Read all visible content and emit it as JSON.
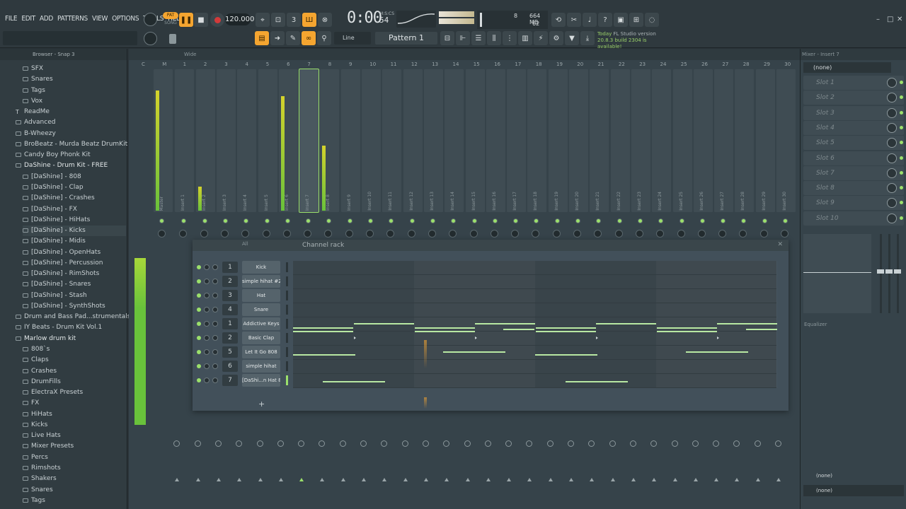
{
  "menu": [
    "FILE",
    "EDIT",
    "ADD",
    "PATTERNS",
    "VIEW",
    "OPTIONS",
    "TOOLS",
    "HELP"
  ],
  "transport": {
    "pat_label": "PAT",
    "song_label": "SONG",
    "tempo": "120.000",
    "time": "0:00",
    "time_small": "54",
    "time_unit": "M:S:CS"
  },
  "cpu": {
    "voices": "8",
    "memory": "664 MB",
    "cpu": "62"
  },
  "toolbar": {
    "snap": "Line",
    "pattern": "Pattern 1"
  },
  "news": {
    "line1": "Today",
    "line1b": "FL Studio version",
    "line2": "20.8.3 build 2304 is available!"
  },
  "browser": {
    "title": "Browser - Snap 3",
    "items": [
      {
        "label": "SFX",
        "indent": 2,
        "type": "folder"
      },
      {
        "label": "Snares",
        "indent": 2,
        "type": "folder"
      },
      {
        "label": "Tags",
        "indent": 2,
        "type": "folder"
      },
      {
        "label": "Vox",
        "indent": 2,
        "type": "folder"
      },
      {
        "label": "ReadMe",
        "indent": 1,
        "type": "file"
      },
      {
        "label": "Advanced",
        "indent": 1,
        "type": "folder"
      },
      {
        "label": "B-Wheezy",
        "indent": 1,
        "type": "folder"
      },
      {
        "label": "BroBeatz - Murda Beatz DrumKit",
        "indent": 1,
        "type": "folder"
      },
      {
        "label": "Candy Boy Phonk Kit",
        "indent": 1,
        "type": "folder"
      },
      {
        "label": "DaShine - Drum Kit - FREE",
        "indent": 1,
        "type": "open"
      },
      {
        "label": "[DaShine] - 808",
        "indent": 2,
        "type": "folder"
      },
      {
        "label": "[DaShine] - Clap",
        "indent": 2,
        "type": "folder"
      },
      {
        "label": "[DaShine] - Crashes",
        "indent": 2,
        "type": "folder"
      },
      {
        "label": "[DaShine] - FX",
        "indent": 2,
        "type": "folder"
      },
      {
        "label": "[DaShine] - HiHats",
        "indent": 2,
        "type": "folder"
      },
      {
        "label": "[DaShine] - Kicks",
        "indent": 2,
        "type": "hl"
      },
      {
        "label": "[DaShine] - Midis",
        "indent": 2,
        "type": "folder"
      },
      {
        "label": "[DaShine] - OpenHats",
        "indent": 2,
        "type": "folder"
      },
      {
        "label": "[DaShine] - Percussion",
        "indent": 2,
        "type": "folder"
      },
      {
        "label": "[DaShine] - RimShots",
        "indent": 2,
        "type": "folder"
      },
      {
        "label": "[DaShine] - Snares",
        "indent": 2,
        "type": "folder"
      },
      {
        "label": "[DaShine] - Stash",
        "indent": 2,
        "type": "folder"
      },
      {
        "label": "[DaShine] - SynthShots",
        "indent": 2,
        "type": "folder"
      },
      {
        "label": "Drum and Bass Pad...strumentals.com)",
        "indent": 1,
        "type": "folder"
      },
      {
        "label": "IY Beats - Drum Kit Vol.1",
        "indent": 1,
        "type": "folder"
      },
      {
        "label": "Marlow drum kit",
        "indent": 1,
        "type": "open"
      },
      {
        "label": "808`s",
        "indent": 2,
        "type": "folder"
      },
      {
        "label": "Claps",
        "indent": 2,
        "type": "folder"
      },
      {
        "label": "Crashes",
        "indent": 2,
        "type": "folder"
      },
      {
        "label": "DrumFills",
        "indent": 2,
        "type": "folder"
      },
      {
        "label": "ElectraX Presets",
        "indent": 2,
        "type": "folder"
      },
      {
        "label": "FX",
        "indent": 2,
        "type": "folder"
      },
      {
        "label": "HiHats",
        "indent": 2,
        "type": "folder"
      },
      {
        "label": "Kicks",
        "indent": 2,
        "type": "folder"
      },
      {
        "label": "Live Hats",
        "indent": 2,
        "type": "folder"
      },
      {
        "label": "Mixer Presets",
        "indent": 2,
        "type": "folder"
      },
      {
        "label": "Percs",
        "indent": 2,
        "type": "folder"
      },
      {
        "label": "Rimshots",
        "indent": 2,
        "type": "folder"
      },
      {
        "label": "Shakers",
        "indent": 2,
        "type": "folder"
      },
      {
        "label": "Snares",
        "indent": 2,
        "type": "folder"
      },
      {
        "label": "Tags",
        "indent": 2,
        "type": "folder"
      }
    ]
  },
  "mixer": {
    "view": "Wide",
    "columns": [
      "C",
      "M",
      "1",
      "2",
      "3",
      "4",
      "5",
      "6",
      "7",
      "8",
      "9",
      "10",
      "11",
      "12",
      "13",
      "14",
      "15",
      "16",
      "17",
      "18",
      "19",
      "20",
      "21",
      "22",
      "23",
      "24",
      "25",
      "26",
      "27",
      "28",
      "29",
      "30"
    ],
    "strips": [
      "Master",
      "Insert 1",
      "Insert 2",
      "Insert 3",
      "Insert 4",
      "Insert 5",
      "Insert 6",
      "Insert 7",
      "Insert 8",
      "Insert 9",
      "Insert 10",
      "Insert 11",
      "Insert 12",
      "Insert 13",
      "Insert 14",
      "Insert 15",
      "Insert 16",
      "Insert 17",
      "Insert 18",
      "Insert 19",
      "Insert 20",
      "Insert 21",
      "Insert 22",
      "Insert 23",
      "Insert 24",
      "Insert 25",
      "Insert 26",
      "Insert 27",
      "Insert 28",
      "Insert 29",
      "Insert 30"
    ],
    "selected_insert": "Insert 7"
  },
  "channel_rack": {
    "title": "Channel rack",
    "filter": "All",
    "add": "+",
    "channels": [
      {
        "num": "1",
        "name": "Kick"
      },
      {
        "num": "2",
        "name": "simple hihat #2"
      },
      {
        "num": "3",
        "name": "Hat"
      },
      {
        "num": "4",
        "name": "Snare"
      },
      {
        "num": "1",
        "name": "Addictive Keys"
      },
      {
        "num": "2",
        "name": "Basic Clap"
      },
      {
        "num": "5",
        "name": "Let It Go 808"
      },
      {
        "num": "6",
        "name": "simple hihat"
      },
      {
        "num": "7",
        "name": "[DaShi...n Hat 8"
      }
    ]
  },
  "mixer_insert": {
    "title": "Mixer - Insert 7",
    "input": "(none)",
    "slots": [
      "Slot 1",
      "Slot 2",
      "Slot 3",
      "Slot 4",
      "Slot 5",
      "Slot 6",
      "Slot 7",
      "Slot 8",
      "Slot 9",
      "Slot 10"
    ],
    "equalizer": "Equalizer",
    "output1": "(none)",
    "output2": "(none)"
  },
  "colors": {
    "accent": "#f5a530",
    "green": "#9be06b",
    "panel": "#36434a"
  }
}
